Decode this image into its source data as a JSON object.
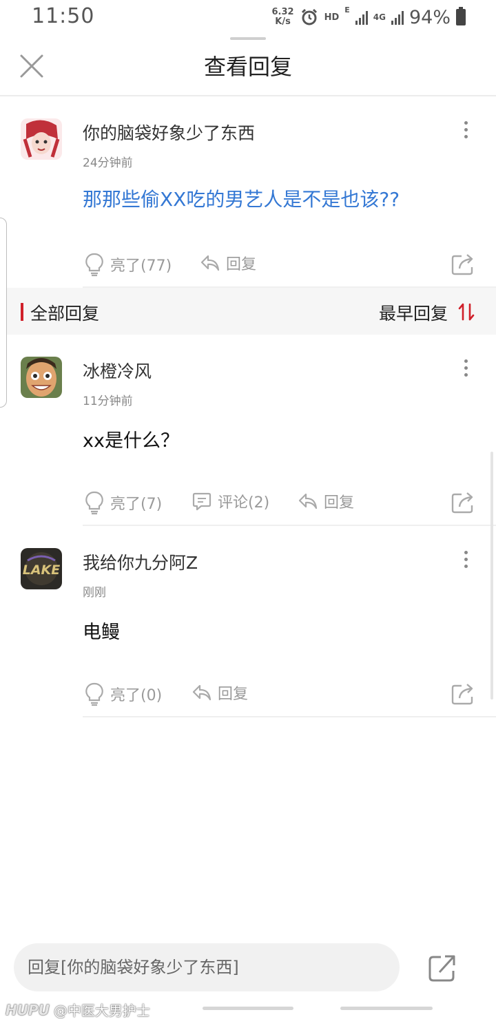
{
  "status_bar": {
    "time": "11:50",
    "net_speed_value": "6.32",
    "net_speed_unit": "K/s",
    "hd_label": "HD",
    "e_label": "E",
    "lte_label": "4G",
    "battery": "94%",
    "icons": [
      "alarm-icon",
      "signal-icon",
      "battery-icon"
    ]
  },
  "header": {
    "title": "查看回复",
    "close_icon": "close-icon"
  },
  "main_post": {
    "username": "你的脑袋好象少了东西",
    "time": "24分钟前",
    "content": "那那些偷XX吃的男艺人是不是也该??",
    "light_label": "亮了(77)",
    "reply_label": "回复"
  },
  "section": {
    "title": "全部回复",
    "sort_label": "最早回复"
  },
  "replies": [
    {
      "username": "冰橙冷风",
      "time": "11分钟前",
      "content": "xx是什么？",
      "light_label": "亮了(7)",
      "comment_label": "评论(2)",
      "reply_label": "回复"
    },
    {
      "username": "我给你九分阿Z",
      "time": "刚刚",
      "content": "电鳗",
      "light_label": "亮了(0)",
      "reply_label": "回复"
    }
  ],
  "bottom_bar": {
    "input_placeholder": "回复[你的脑袋好象少了东西]"
  },
  "watermark": {
    "brand": "HUPU",
    "user": "@中医大男护士"
  },
  "colors": {
    "accent_red": "#d0202a",
    "link_blue": "#3478d4",
    "muted_gray": "#9a9a9a"
  }
}
